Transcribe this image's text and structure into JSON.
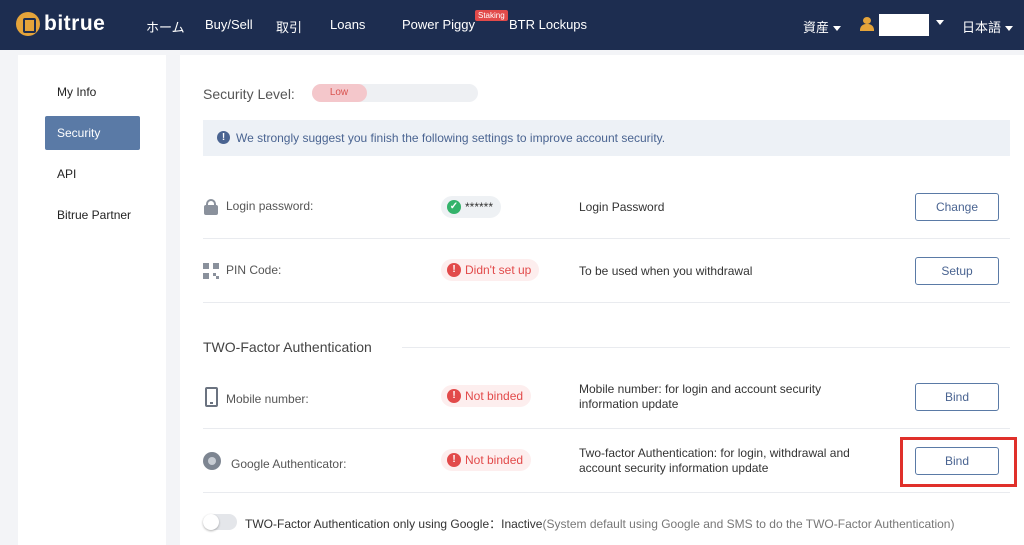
{
  "nav": {
    "logo_text": "bitrue",
    "items": [
      "ホーム",
      "Buy/Sell",
      "取引",
      "Loans",
      "Power Piggy",
      "BTR Lockups"
    ],
    "badge": "Staking",
    "assets": "資産",
    "language": "日本語"
  },
  "sidebar": {
    "items": [
      {
        "label": "My Info"
      },
      {
        "label": "Security"
      },
      {
        "label": "API"
      },
      {
        "label": "Bitrue Partner"
      }
    ]
  },
  "security": {
    "level_label": "Security Level:",
    "level_value": "Low",
    "level_fraction": 0.33,
    "notice": "We strongly suggest you finish the following settings to improve account security."
  },
  "rows": [
    {
      "label": "Login password:",
      "status": "******",
      "status_type": "ok",
      "desc": "Login Password",
      "button": "Change"
    },
    {
      "label": "PIN Code:",
      "status": "Didn't set up",
      "status_type": "bad",
      "desc": "To be used when you withdrawal",
      "button": "Setup"
    }
  ],
  "tfa": {
    "title": "TWO-Factor Authentication",
    "rows": [
      {
        "label": "Mobile number:",
        "status": "Not binded",
        "status_type": "bad",
        "desc": "Mobile number: for login and account security information update",
        "button": "Bind"
      },
      {
        "label": "Google Authenticator:",
        "status": "Not binded",
        "status_type": "bad",
        "desc": "Two-factor Authentication: for login, withdrawal and account security information update",
        "button": "Bind"
      }
    ],
    "toggle_label": "TWO-Factor Authentication only using Google：Inactive",
    "toggle_note": "(System default using Google and SMS to do the TWO-Factor Authentication)"
  },
  "colors": {
    "nav_bg": "#1d2d50",
    "accent": "#5a7aa6",
    "danger": "#e24a4a",
    "success": "#34b36b",
    "highlight": "#e0302a"
  }
}
